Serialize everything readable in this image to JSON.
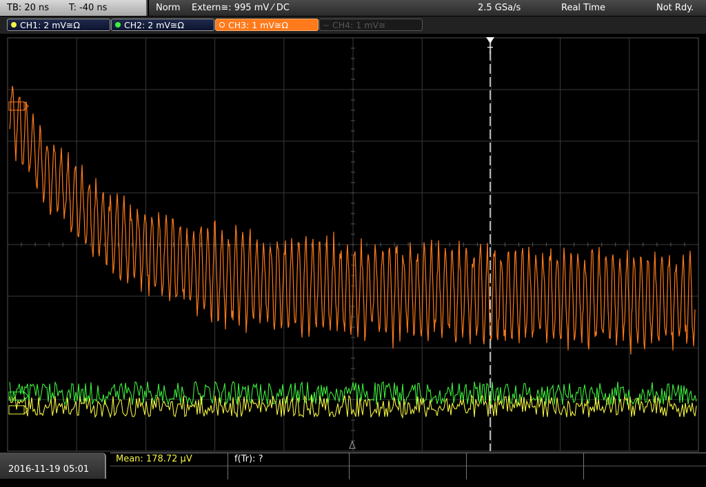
{
  "top": {
    "timebase": "TB: 20 ns",
    "trigger_time": "T: -40 ns",
    "mode": "Norm",
    "trigger": "Extern≅: 995 mV ⁄ DC",
    "sample_rate": "2.5 GSa/s",
    "acq": "Real Time",
    "state": "Not Rdy."
  },
  "channels": [
    {
      "label": "CH1: 2 mV≅Ω",
      "color": "#f5f542",
      "enabled": true
    },
    {
      "label": "CH2: 2 mV≅Ω",
      "color": "#3cf03c",
      "enabled": true
    },
    {
      "label": "CH3: 1 mV≅Ω",
      "color": "#ff7a1a",
      "enabled": true,
      "active": true
    },
    {
      "label": "CH4: 1 mV≅",
      "color": "#555555",
      "enabled": false
    }
  ],
  "trigger_marker": "T",
  "bottom": {
    "datetime": "2016-11-19 05:01",
    "mean_label": "Mean: 178.72 µV",
    "ftr_label": "f(Tr): ?"
  },
  "colors": {
    "ch1": "#f5f542",
    "ch2": "#3cf03c",
    "ch3": "#ff7a1a",
    "grid": "#3a3a3a"
  }
}
